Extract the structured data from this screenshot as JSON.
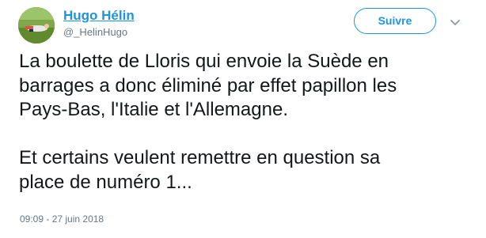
{
  "author": {
    "name": "Hugo Hélin",
    "handle": "@_HelinHugo",
    "avatar_icon": "football-player-avatar"
  },
  "follow_button": {
    "label": "Suivre"
  },
  "menu_icon": "chevron-down-icon",
  "tweet": {
    "paragraph_1": "La boulette de Lloris qui envoie la Suède en\nbarrages a donc éliminé par effet papillon les\nPays-Bas, l'Italie et l'Allemagne.",
    "paragraph_2": "Et certains veulent remettre en question sa\nplace de numéro 1..."
  },
  "timestamp": "09:09 - 27 juin 2018",
  "colors": {
    "accent": "#1b95e0",
    "secondary_text": "#657786",
    "primary_text": "#14171a"
  }
}
